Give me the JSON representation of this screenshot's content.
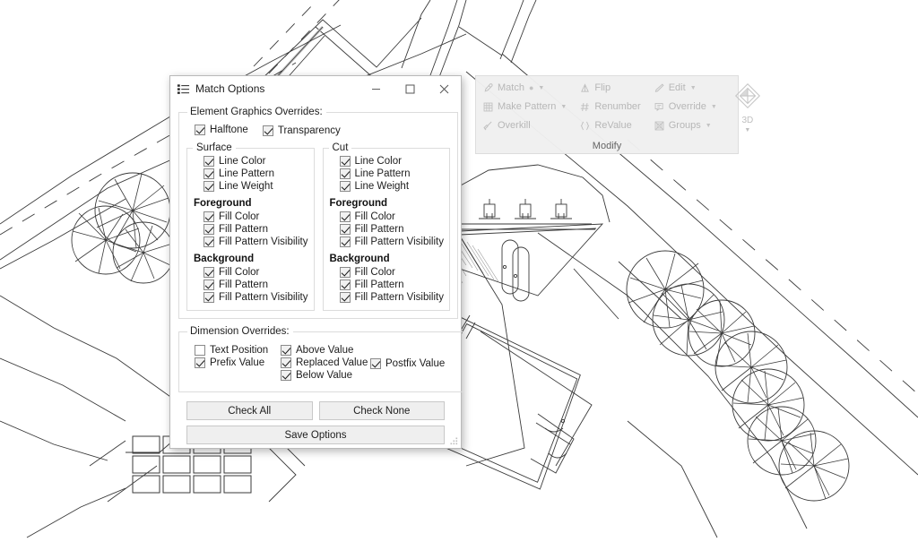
{
  "application": {
    "background_description": "CAD site plan drawing with roads, contour lines, tree symbols, parking stalls and a building"
  },
  "ribbon": {
    "panel_label": "Modify",
    "enabled": false,
    "columns": [
      {
        "items": [
          {
            "label": "Match",
            "icon": "eyedropper-icon",
            "has_dot": true,
            "has_dropdown": true
          },
          {
            "label": "Make Pattern",
            "icon": "pattern-icon",
            "has_dot": false,
            "has_dropdown": true
          },
          {
            "label": "Overkill",
            "icon": "broom-icon",
            "has_dot": false,
            "has_dropdown": false
          }
        ]
      },
      {
        "items": [
          {
            "label": "Flip",
            "icon": "flip-icon",
            "has_dot": false,
            "has_dropdown": false
          },
          {
            "label": "Renumber",
            "icon": "hash-icon",
            "has_dot": false,
            "has_dropdown": false
          },
          {
            "label": "ReValue",
            "icon": "braces-icon",
            "has_dot": false,
            "has_dropdown": false
          }
        ]
      },
      {
        "items": [
          {
            "label": "Edit",
            "icon": "pencil-icon",
            "has_dot": false,
            "has_dropdown": true
          },
          {
            "label": "Override",
            "icon": "override-icon",
            "has_dot": false,
            "has_dropdown": true
          },
          {
            "label": "Groups",
            "icon": "groups-icon",
            "has_dot": false,
            "has_dropdown": true
          }
        ]
      }
    ],
    "big_button": {
      "label": "3D",
      "icon": "3d-view-cube-icon",
      "has_dropdown": true
    }
  },
  "dialog": {
    "title": "Match Options",
    "title_icon": "properties-list-icon",
    "window_buttons": {
      "minimize": "minimize-icon",
      "maximize": "maximize-icon",
      "close": "close-icon"
    },
    "element_graphics": {
      "legend": "Element Graphics Overrides:",
      "top_checks": [
        {
          "label": "Halftone",
          "checked": true
        },
        {
          "label": "Transparency",
          "checked": true
        }
      ],
      "columns": [
        {
          "legend": "Surface",
          "line_items": [
            {
              "label": "Line Color",
              "checked": true
            },
            {
              "label": "Line Pattern",
              "checked": true
            },
            {
              "label": "Line Weight",
              "checked": true
            }
          ],
          "foreground_head": "Foreground",
          "foreground_items": [
            {
              "label": "Fill Color",
              "checked": true
            },
            {
              "label": "Fill Pattern",
              "checked": true
            },
            {
              "label": "Fill Pattern Visibility",
              "checked": true
            }
          ],
          "background_head": "Background",
          "background_items": [
            {
              "label": "Fill Color",
              "checked": true
            },
            {
              "label": "Fill Pattern",
              "checked": true
            },
            {
              "label": "Fill Pattern Visibility",
              "checked": true
            }
          ]
        },
        {
          "legend": "Cut",
          "line_items": [
            {
              "label": "Line Color",
              "checked": true
            },
            {
              "label": "Line Pattern",
              "checked": true
            },
            {
              "label": "Line Weight",
              "checked": true
            }
          ],
          "foreground_head": "Foreground",
          "foreground_items": [
            {
              "label": "Fill Color",
              "checked": true
            },
            {
              "label": "Fill Pattern",
              "checked": true
            },
            {
              "label": "Fill Pattern Visibility",
              "checked": true
            }
          ],
          "background_head": "Background",
          "background_items": [
            {
              "label": "Fill Color",
              "checked": true
            },
            {
              "label": "Fill Pattern",
              "checked": true
            },
            {
              "label": "Fill Pattern Visibility",
              "checked": true
            }
          ]
        }
      ]
    },
    "dimension_overrides": {
      "legend": "Dimension Overrides:",
      "column1": [
        {
          "label": "Text Position",
          "checked": false
        },
        {
          "label": "Prefix Value",
          "checked": true
        }
      ],
      "column2": [
        {
          "label": "Above Value",
          "checked": true
        },
        {
          "label": "Replaced Value",
          "checked": true
        },
        {
          "label": "Below Value",
          "checked": true
        }
      ],
      "column3": [
        {
          "label": "Postfix Value",
          "checked": true
        }
      ]
    },
    "buttons": {
      "check_all": "Check All",
      "check_none": "Check None",
      "save_options": "Save Options"
    }
  },
  "colors": {
    "dialog_border": "#b9b9b9",
    "group_border": "#dcdcdc",
    "button_face": "#efefef",
    "ribbon_face": "#f0f0f0",
    "disabled_text": "#b5b5b5",
    "text": "#1d1d1d",
    "drawing_line": "#3a3a3a"
  }
}
